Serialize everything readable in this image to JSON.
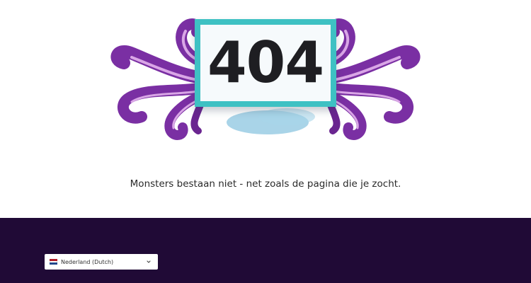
{
  "error": {
    "code": "404",
    "message": "Monsters bestaan niet - net zoals de pagina die je zocht."
  },
  "colors": {
    "frame_border": "#3ec1c3",
    "tentacle_purple": "#7a2fa3",
    "tentacle_light": "#d9a6e6",
    "shadow_blue": "#8cc6e0",
    "footer_background": "#200a36"
  },
  "footer": {
    "language_selector": {
      "selected": "Nederland (Dutch)",
      "flag_colors": [
        "#ae1c28",
        "#ffffff",
        "#21468b"
      ],
      "icon": "chevron-down-icon"
    }
  }
}
